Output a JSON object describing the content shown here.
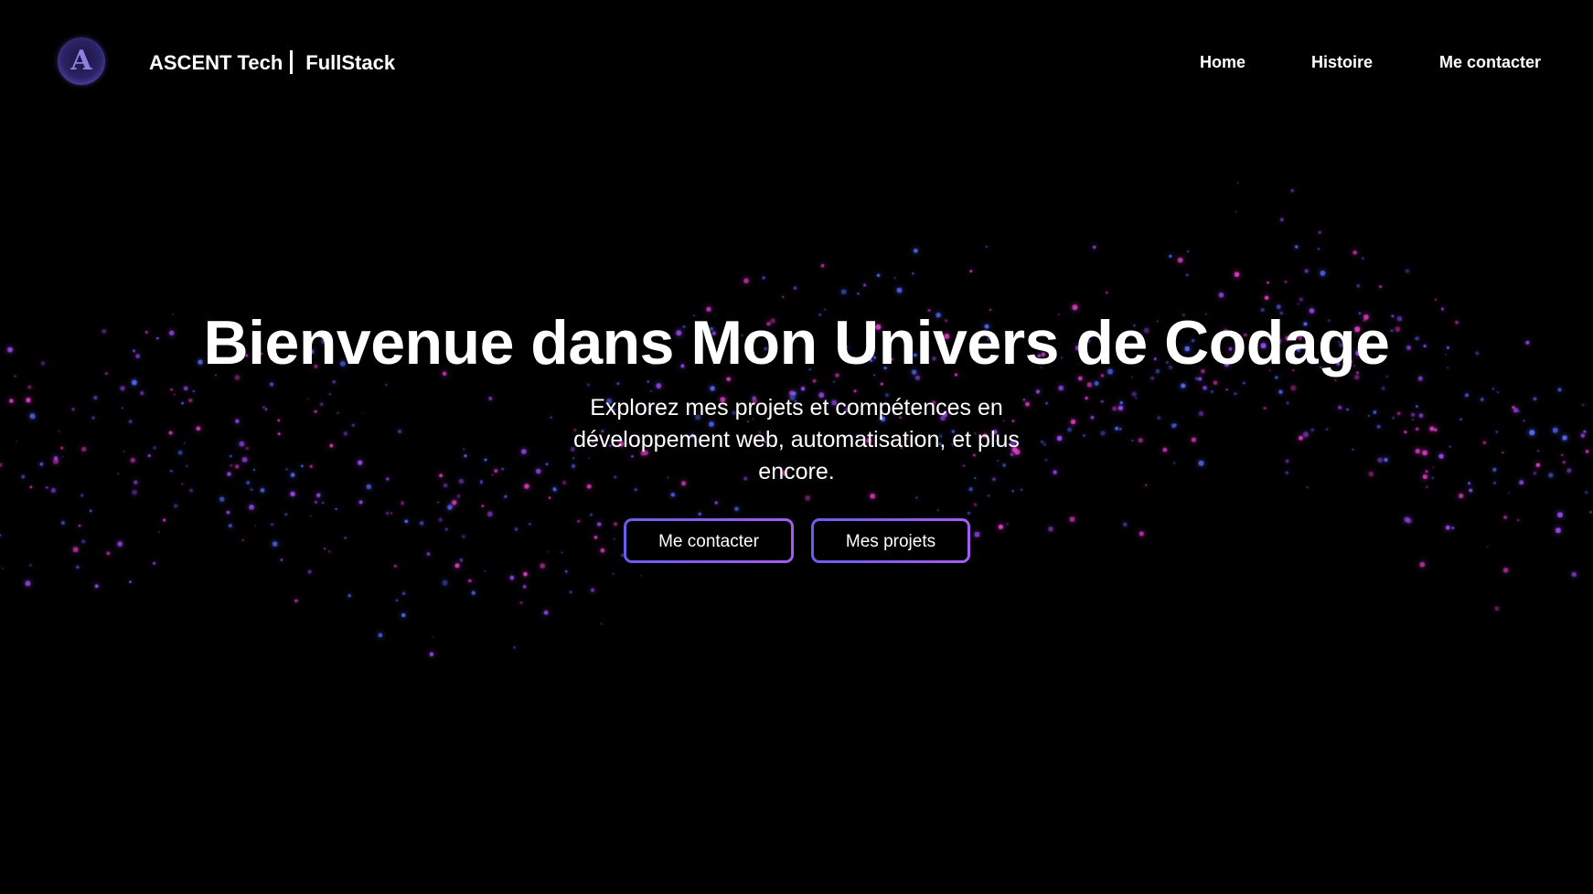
{
  "header": {
    "logo_letter": "A",
    "brand_name": "ASCENT Tech",
    "brand_tagline": "FullStack"
  },
  "nav": {
    "items": [
      {
        "label": "Home"
      },
      {
        "label": "Histoire"
      },
      {
        "label": "Me contacter"
      }
    ]
  },
  "hero": {
    "title": "Bienvenue dans Mon Univers de Codage",
    "subtitle": "Explorez mes projets et compétences en développement web, automatisation, et plus encore.",
    "buttons": [
      {
        "label": "Me contacter"
      },
      {
        "label": "Mes projets"
      }
    ]
  },
  "colors": {
    "background": "#000000",
    "accent_start": "#6a5cf0",
    "accent_end": "#a55cf0",
    "particle_pink": "#e040c8",
    "particle_blue": "#5a6cff"
  }
}
